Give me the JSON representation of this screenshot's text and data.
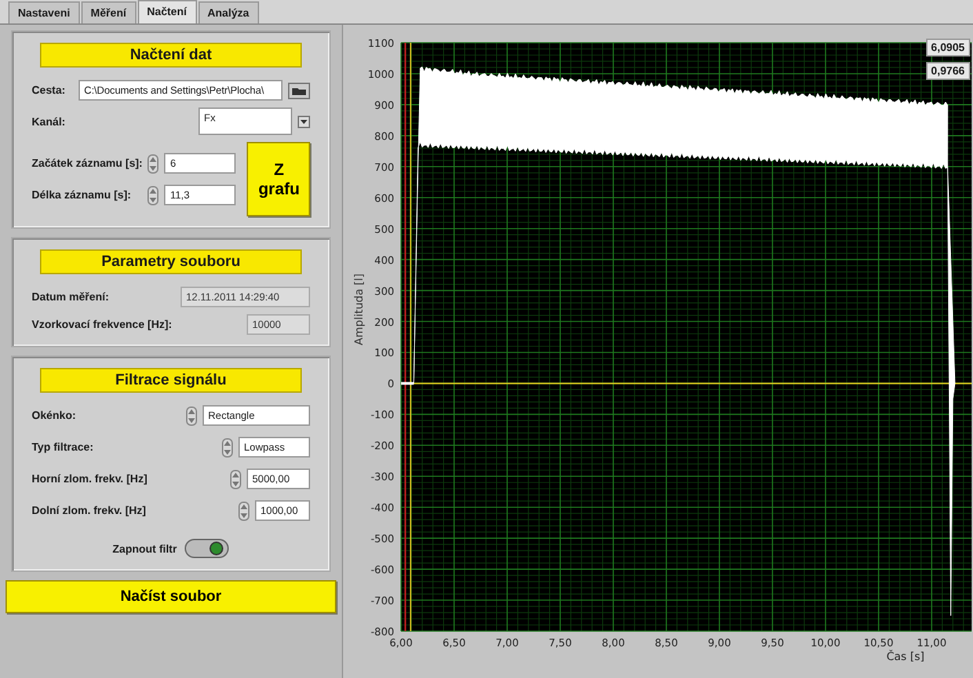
{
  "tabs": [
    {
      "label": "Nastaveni",
      "selected": false
    },
    {
      "label": "Měření",
      "selected": false
    },
    {
      "label": "Načtení",
      "selected": true
    },
    {
      "label": "Analýza",
      "selected": false
    }
  ],
  "load_section": {
    "title": "Načtení dat",
    "path": {
      "label": "Cesta:",
      "value": "C:\\Documents and Settings\\Petr\\Plocha\\"
    },
    "channel": {
      "label": "Kanál:",
      "value": "Fx"
    },
    "start": {
      "label": "Začátek záznamu [s]:",
      "value": "6"
    },
    "length": {
      "label": "Délka záznamu [s]:",
      "value": "11,3"
    },
    "from_graph_button": "Z grafu"
  },
  "file_params": {
    "title": "Parametry souboru",
    "fields": [
      {
        "label": "Datum měření:",
        "value": "12.11.2011 14:29:40"
      },
      {
        "label": "Vzorkovací frekvence [Hz]:",
        "value": "10000"
      }
    ]
  },
  "filter": {
    "title": "Filtrace signálu",
    "fields": [
      {
        "label": "Okénko:",
        "value": "Rectangle"
      },
      {
        "label": "Typ filtrace:",
        "value": "Lowpass"
      },
      {
        "label": "Horní zlom. frekv. [Hz]",
        "value": "5000,00"
      },
      {
        "label": "Dolní zlom. frekv. [Hz]",
        "value": "1000,00"
      }
    ],
    "toggle": {
      "label": "Zapnout filtr",
      "on": true
    }
  },
  "load_button": "Načíst soubor",
  "graph": {
    "ylabel": "Amplituda [l]",
    "xlabel": "Čas [s]",
    "yticks": [
      "1100",
      "1000",
      "900",
      "800",
      "700",
      "600",
      "500",
      "400",
      "300",
      "200",
      "100",
      "0",
      "-100",
      "-200",
      "-300",
      "-400",
      "-500",
      "-600",
      "-700",
      "-800"
    ],
    "xticks": [
      "6,00",
      "6,50",
      "7,00",
      "7,50",
      "8,00",
      "8,50",
      "9,00",
      "9,50",
      "10,00",
      "10,50",
      "11,00"
    ],
    "cursor_readouts": [
      "6,0905",
      "0,9766"
    ]
  }
}
